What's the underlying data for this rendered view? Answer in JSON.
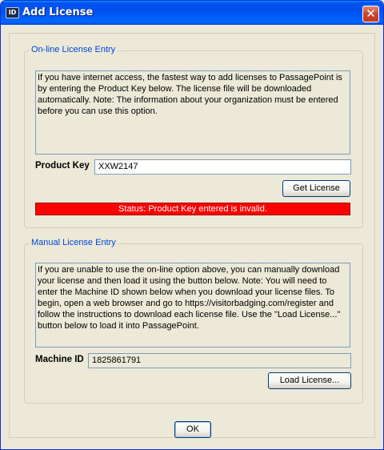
{
  "window": {
    "title": "Add License",
    "icon_label": "ID",
    "close_glyph": "✕"
  },
  "online": {
    "legend": "On-line License Entry",
    "description": "If you have internet access, the fastest way to add licenses to PassagePoint is by entering the Product Key below. The license file will be downloaded automatically. Note: The information about your organization must be entered before you can use this option.",
    "product_key_label": "Product Key",
    "product_key_value": "XXW2147",
    "get_license_label": "Get License",
    "status_text": "Status: Product Key entered is invalid.",
    "status_color": "#ff0000"
  },
  "manual": {
    "legend": "Manual License Entry",
    "description": "If you are unable to use the on-line option above, you can manually download your license and then load it using the button below. Note: You will need to enter the Machine ID shown below when you download your license files. To begin, open a web browser and go to https://visitorbadging.com/register and follow the instructions to download each license file. Use the \"Load License...\" button below to load it into PassagePoint.",
    "machine_id_label": "Machine ID",
    "machine_id_value": "1825861791",
    "load_license_label": "Load License..."
  },
  "footer": {
    "ok_label": "OK"
  }
}
